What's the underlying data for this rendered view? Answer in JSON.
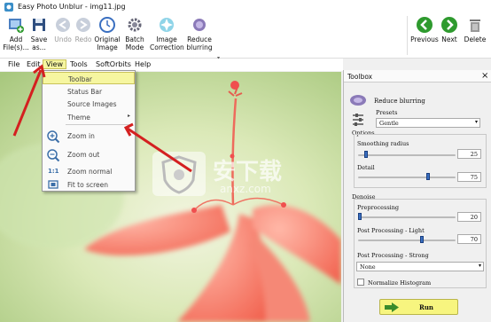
{
  "window": {
    "title": "Easy Photo Unblur - img11.jpg"
  },
  "toolbar": {
    "add": "Add\nFile(s)...",
    "save": "Save\nas...",
    "undo": "Undo",
    "redo": "Redo",
    "original": "Original\nImage",
    "batch": "Batch\nMode",
    "correction": "Image\nCorrection",
    "reduce": "Reduce\nblurring",
    "previous": "Previous",
    "next": "Next",
    "delete": "Delete"
  },
  "menu": {
    "file": "File",
    "edit": "Edit",
    "view": "View",
    "tools": "Tools",
    "softorbits": "SoftOrbits",
    "help": "Help"
  },
  "view_menu": {
    "toolbar": "Toolbar",
    "status_bar": "Status Bar",
    "source_images": "Source Images",
    "theme": "Theme",
    "zoom_in": "Zoom in",
    "zoom_out": "Zoom out",
    "zoom_normal": "Zoom normal",
    "fit": "Fit to screen",
    "zoom_normal_icon": "1:1"
  },
  "toolbox": {
    "title": "Toolbox",
    "close": "×",
    "reduce_label": "Reduce blurring",
    "presets_label": "Presets",
    "preset_value": "Gentle",
    "options_label": "Options",
    "smoothing_label": "Smoothing radius",
    "smoothing_value": "25",
    "smoothing_level": 0.08,
    "detail_label": "Detail",
    "detail_value": "75",
    "detail_level": 0.72,
    "denoise_label": "Denoise",
    "pre_label": "Preprocessing",
    "pre_value": "20",
    "pre_level": 0.02,
    "post_light_label": "Post Processing - Light",
    "post_light_value": "70",
    "post_light_level": 0.65,
    "post_strong_label": "Post Processing - Strong",
    "post_strong_value": "None",
    "normalize_label": "Normalize Histogram",
    "run_label": "Run"
  },
  "watermark": {
    "text": "安下载",
    "subtext": "anxz.com"
  },
  "colors": {
    "highlight": "#f6f6a0",
    "run_button": "#f7f57f",
    "run_arrow": "#3a8c2b",
    "nav_green": "#2e9a2e",
    "arrow_red": "#d42020"
  }
}
